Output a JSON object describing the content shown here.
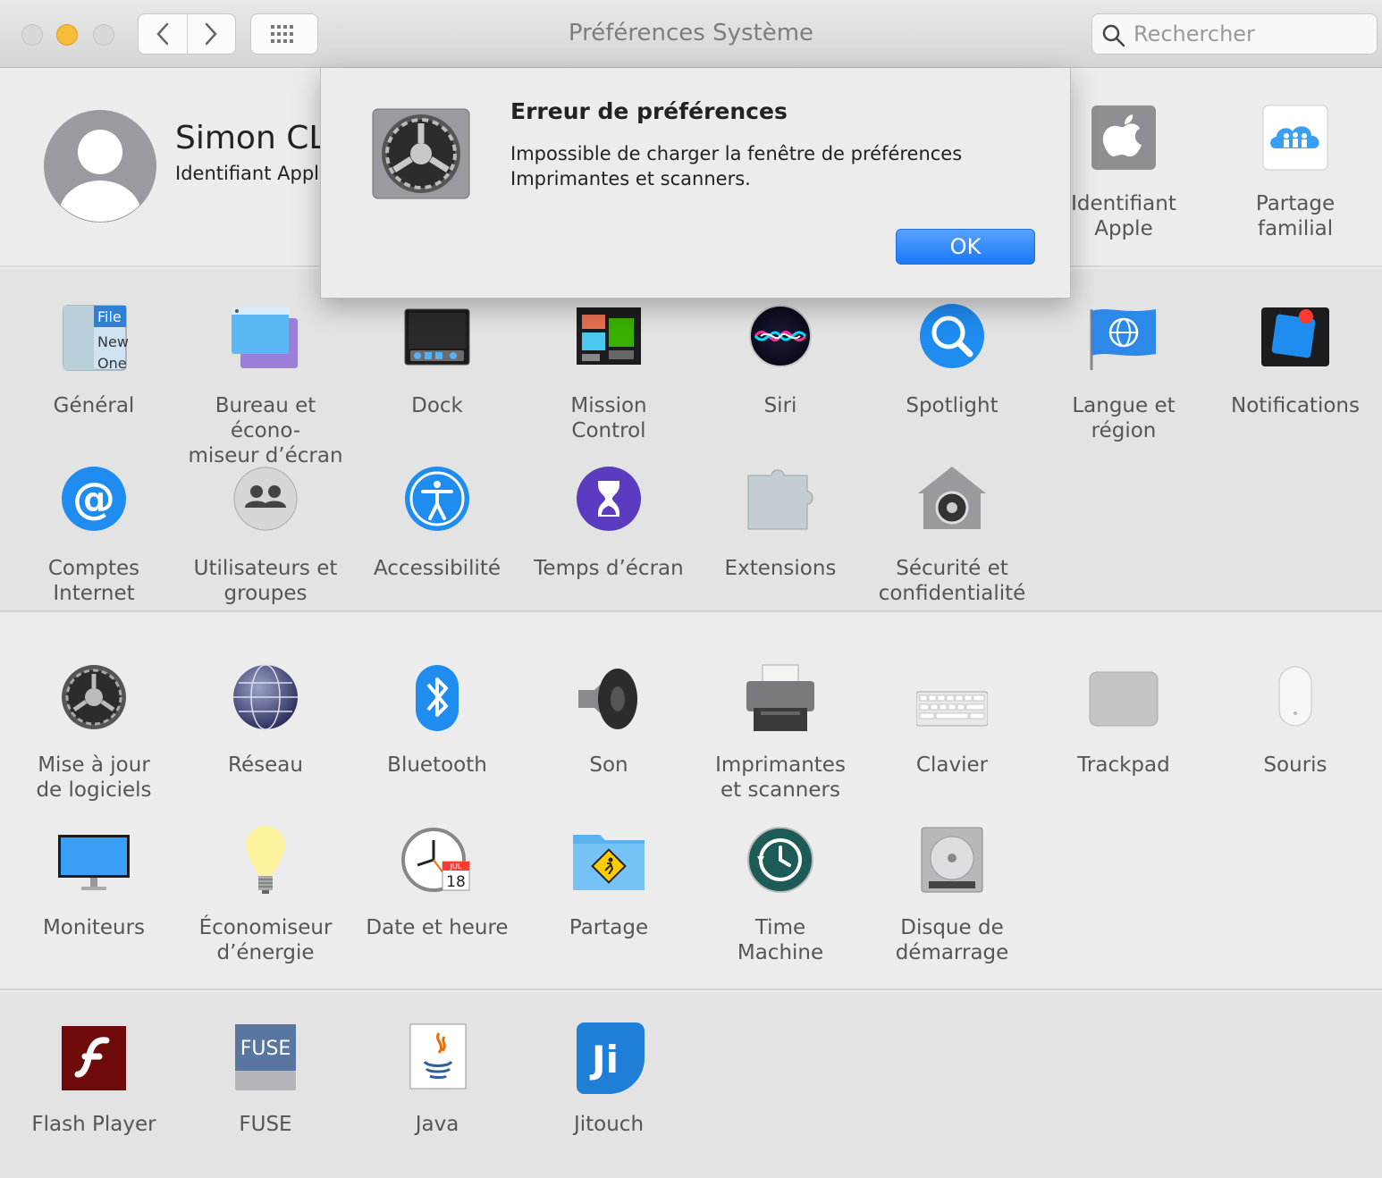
{
  "window": {
    "title": "Préférences Système",
    "search_placeholder": "Rechercher"
  },
  "user": {
    "name": "Simon CLE",
    "subtitle": "Identifiant Apple"
  },
  "account_panes": [
    {
      "id": "apple-id",
      "label": "Identifiant\nApple",
      "icon": "apple-id-icon"
    },
    {
      "id": "family-sharing",
      "label": "Partage\nfamilial",
      "icon": "family-sharing-icon"
    }
  ],
  "section1": [
    {
      "id": "general",
      "label": "Général",
      "icon": "general-icon"
    },
    {
      "id": "desktop",
      "label": "Bureau et écono-\nmiseur d’écran",
      "icon": "desktop-screensaver-icon"
    },
    {
      "id": "dock",
      "label": "Dock",
      "icon": "dock-icon"
    },
    {
      "id": "mission-control",
      "label": "Mission\nControl",
      "icon": "mission-control-icon"
    },
    {
      "id": "siri",
      "label": "Siri",
      "icon": "siri-icon"
    },
    {
      "id": "spotlight",
      "label": "Spotlight",
      "icon": "spotlight-icon"
    },
    {
      "id": "language",
      "label": "Langue et\nrégion",
      "icon": "language-region-icon"
    },
    {
      "id": "notifications",
      "label": "Notifications",
      "icon": "notifications-icon"
    },
    {
      "id": "internet-accounts",
      "label": "Comptes\nInternet",
      "icon": "internet-accounts-icon"
    },
    {
      "id": "users",
      "label": "Utilisateurs et\ngroupes",
      "icon": "users-groups-icon"
    },
    {
      "id": "accessibility",
      "label": "Accessibilité",
      "icon": "accessibility-icon"
    },
    {
      "id": "screen-time",
      "label": "Temps d’écran",
      "icon": "screen-time-icon"
    },
    {
      "id": "extensions",
      "label": "Extensions",
      "icon": "extensions-icon"
    },
    {
      "id": "security",
      "label": "Sécurité et\nconfidentialité",
      "icon": "security-privacy-icon"
    }
  ],
  "section2": [
    {
      "id": "software-update",
      "label": "Mise à jour\nde logiciels",
      "icon": "software-update-icon"
    },
    {
      "id": "network",
      "label": "Réseau",
      "icon": "network-icon"
    },
    {
      "id": "bluetooth",
      "label": "Bluetooth",
      "icon": "bluetooth-icon"
    },
    {
      "id": "sound",
      "label": "Son",
      "icon": "sound-icon"
    },
    {
      "id": "printers",
      "label": "Imprimantes\net scanners",
      "icon": "printer-icon"
    },
    {
      "id": "keyboard",
      "label": "Clavier",
      "icon": "keyboard-icon"
    },
    {
      "id": "trackpad",
      "label": "Trackpad",
      "icon": "trackpad-icon"
    },
    {
      "id": "mouse",
      "label": "Souris",
      "icon": "mouse-icon"
    },
    {
      "id": "displays",
      "label": "Moniteurs",
      "icon": "displays-icon"
    },
    {
      "id": "energy",
      "label": "Économiseur\nd’énergie",
      "icon": "energy-saver-icon"
    },
    {
      "id": "date-time",
      "label": "Date et heure",
      "icon": "date-time-icon",
      "calendar_month": "JUL",
      "calendar_day": "18"
    },
    {
      "id": "sharing",
      "label": "Partage",
      "icon": "sharing-icon"
    },
    {
      "id": "time-machine",
      "label": "Time\nMachine",
      "icon": "time-machine-icon"
    },
    {
      "id": "startup-disk",
      "label": "Disque de\ndémarrage",
      "icon": "startup-disk-icon"
    }
  ],
  "section3": [
    {
      "id": "flash",
      "label": "Flash Player",
      "icon": "flash-player-icon"
    },
    {
      "id": "fuse",
      "label": "FUSE",
      "icon": "fuse-icon",
      "badge": "FUSE"
    },
    {
      "id": "java",
      "label": "Java",
      "icon": "java-icon"
    },
    {
      "id": "jitouch",
      "label": "Jitouch",
      "icon": "jitouch-icon",
      "badge": "Ji"
    }
  ],
  "general_icon_text": [
    "File",
    "New",
    "One"
  ],
  "dialog": {
    "title": "Erreur de préférences",
    "message": "Impossible de charger la fenêtre de préférences\nImprimantes et scanners.",
    "ok_label": "OK"
  }
}
